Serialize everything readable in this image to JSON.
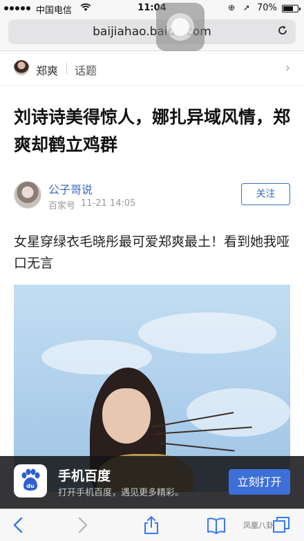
{
  "status_bar": {
    "carrier": "中国电信",
    "time": "11:04",
    "battery_text": "70%",
    "battery_level": 0.7,
    "icons": [
      "signal-dots-icon",
      "wifi-icon",
      "orientation-lock-icon",
      "location-arrow-icon",
      "battery-icon"
    ]
  },
  "browser": {
    "url": "baijiahao.baidu.com",
    "reload_icon": "reload-icon"
  },
  "topic": {
    "name": "郑爽",
    "tag": "话题",
    "chevron_icon": "chevron-right-icon"
  },
  "article": {
    "title": "刘诗诗美得惊人，娜扎异域风情，郑爽却鹤立鸡群",
    "author": {
      "name": "公子哥说",
      "source": "百家号",
      "date": "11-21 14:05",
      "follow_label": "关注"
    },
    "lead": "女星穿绿衣毛晓彤最可爱郑爽最土！看到她我哑口无言"
  },
  "promo": {
    "title": "手机百度",
    "subtitle": "打开手机百度，遇见更多精彩。",
    "open_label": "立刻打开",
    "icon": "baidu-paw-icon"
  },
  "toolbar": {
    "icons": [
      "back-arrow-icon",
      "forward-arrow-icon",
      "share-icon",
      "bookmarks-icon",
      "tabs-icon"
    ]
  },
  "watermark": "凤凰八卦"
}
